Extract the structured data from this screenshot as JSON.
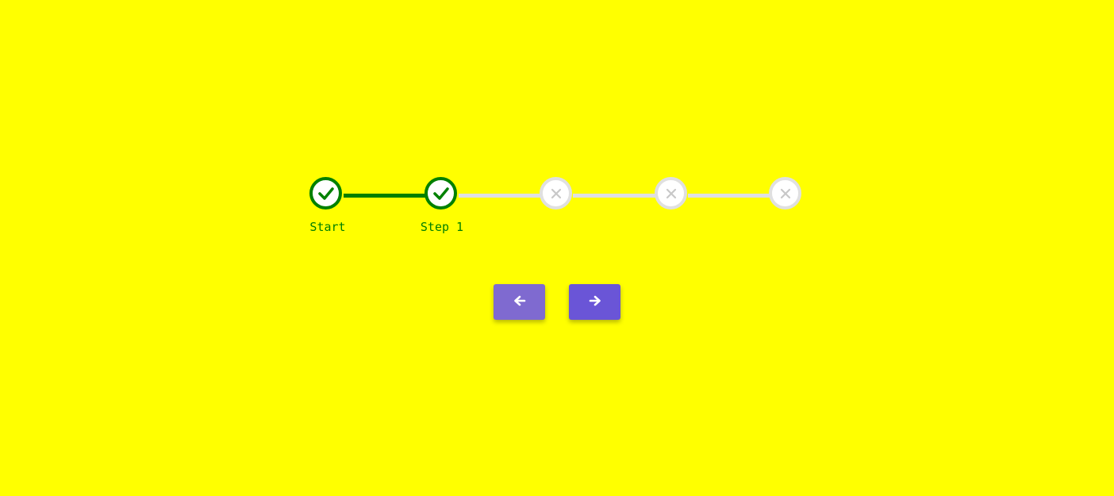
{
  "stepper": {
    "steps": [
      {
        "label": "Start",
        "status": "complete",
        "icon": "check-icon"
      },
      {
        "label": "Step 1",
        "status": "complete",
        "icon": "check-icon"
      },
      {
        "label": "",
        "status": "incomplete",
        "icon": "close-icon"
      },
      {
        "label": "",
        "status": "incomplete",
        "icon": "close-icon"
      },
      {
        "label": "",
        "status": "incomplete",
        "icon": "close-icon"
      }
    ],
    "complete_color": "#008000",
    "incomplete_color": "#e0e0e0"
  },
  "navigation": {
    "prev_icon": "arrow-left-icon",
    "next_icon": "arrow-right-icon",
    "prev_color": "#7f6ad0",
    "next_color": "#6a55d7"
  },
  "colors": {
    "background": "#ffff00"
  }
}
